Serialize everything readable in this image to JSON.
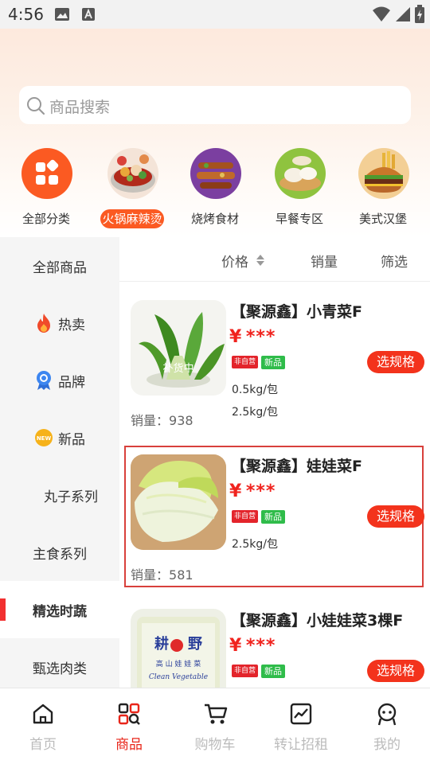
{
  "status_bar": {
    "time": "4:56"
  },
  "search": {
    "placeholder": "商品搜索"
  },
  "categories": [
    {
      "label": "全部分类",
      "active": false
    },
    {
      "label": "火锅麻辣烫",
      "active": true
    },
    {
      "label": "烧烤食材",
      "active": false
    },
    {
      "label": "早餐专区",
      "active": false
    },
    {
      "label": "美式汉堡",
      "active": false
    }
  ],
  "sidebar": {
    "items": [
      {
        "label": "全部商品"
      },
      {
        "label": "热卖"
      },
      {
        "label": "品牌"
      },
      {
        "label": "新品"
      },
      {
        "label": "丸子系列"
      },
      {
        "label": "主食系列"
      },
      {
        "label": "精选时蔬",
        "active": true
      },
      {
        "label": "甄选肉类"
      }
    ]
  },
  "sort_bar": {
    "price": "价格",
    "sales": "销量",
    "filter": "筛选"
  },
  "products": [
    {
      "name": "【聚源鑫】小青菜F",
      "price_symbol": "¥",
      "price": "***",
      "tag_self": "非自营",
      "tag_new": "新品",
      "specs": [
        "0.5kg/包",
        "2.5kg/包"
      ],
      "sales_label": "销量：",
      "sales": "938",
      "button": "选规格",
      "image_watermark": "补货中"
    },
    {
      "name": "【聚源鑫】娃娃菜F",
      "price_symbol": "¥",
      "price": "***",
      "tag_self": "非自营",
      "tag_new": "新品",
      "specs": [
        "2.5kg/包"
      ],
      "sales_label": "销量：",
      "sales": "581",
      "button": "选规格"
    },
    {
      "name": "【聚源鑫】小娃娃菜3棵F",
      "price_symbol": "¥",
      "price": "***",
      "tag_self": "非自营",
      "tag_new": "新品",
      "button": "选规格",
      "package_text": "耕 野 高山娃娃菜 Clean Vegetable"
    }
  ],
  "bottom_nav": [
    {
      "label": "首页",
      "active": false
    },
    {
      "label": "商品",
      "active": true
    },
    {
      "label": "购物车",
      "active": false
    },
    {
      "label": "转让招租",
      "active": false
    },
    {
      "label": "我的",
      "active": false
    }
  ],
  "colors": {
    "accent": "#fb5a22",
    "price": "#f0231e",
    "active_nav": "#e8261a"
  }
}
